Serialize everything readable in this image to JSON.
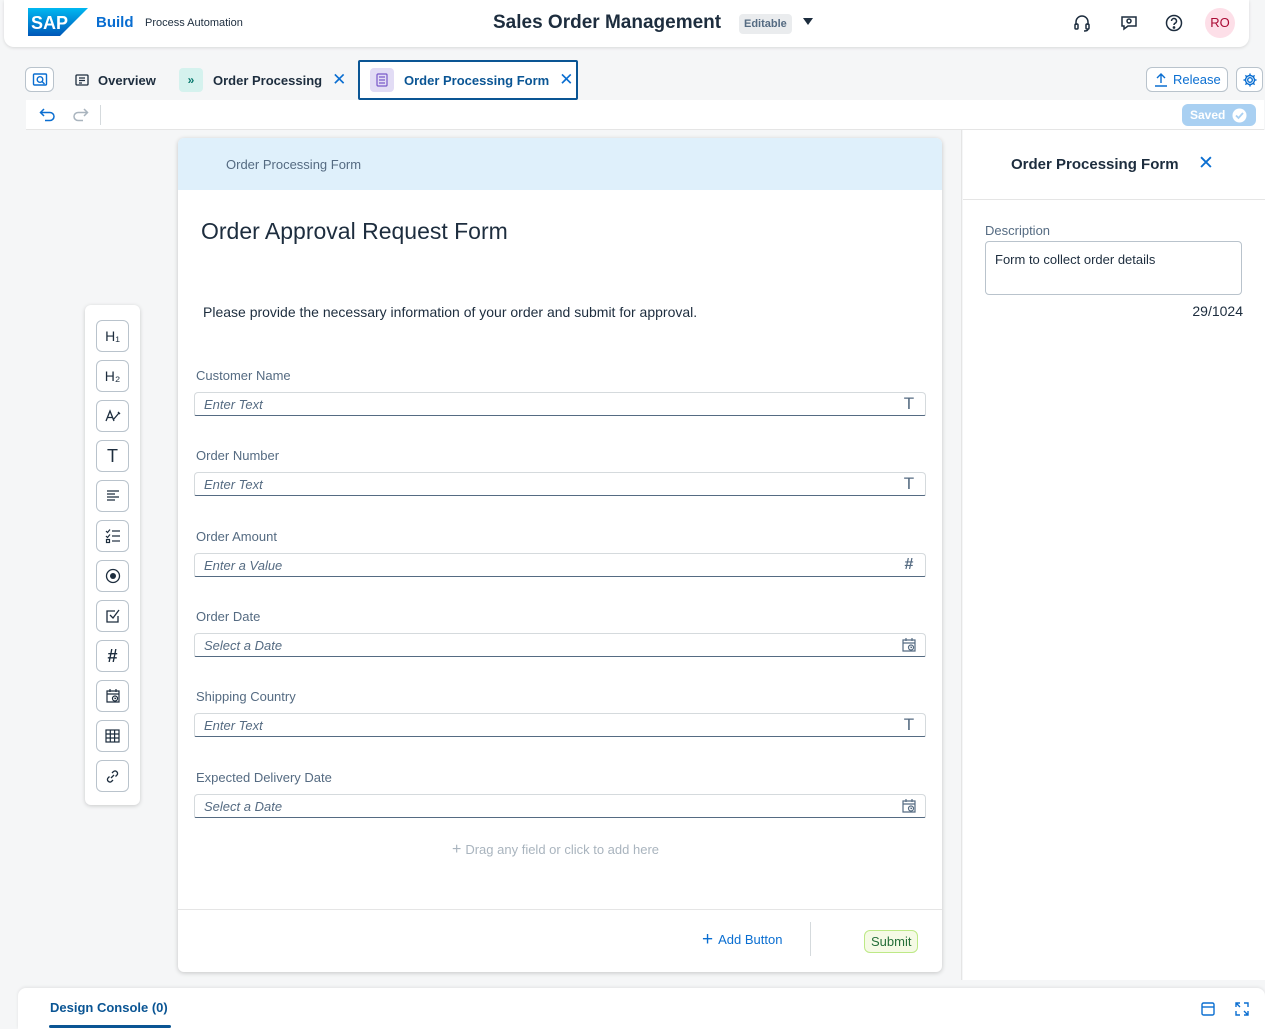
{
  "shell": {
    "brand": "SAP",
    "product": "Build",
    "subproduct": "Process Automation",
    "title": "Sales Order Management",
    "status_badge": "Editable",
    "avatar_initials": "RO"
  },
  "tabs": [
    {
      "label": "Overview"
    },
    {
      "label": "Order Processing"
    },
    {
      "label": "Order Processing Form"
    }
  ],
  "actions": {
    "release_label": "Release",
    "saved_label": "Saved"
  },
  "form": {
    "header_label": "Order Processing Form",
    "title": "Order Approval Request Form",
    "description": "Please provide the necessary information of your order and submit for approval.",
    "fields": [
      {
        "label": "Customer Name",
        "placeholder": "Enter Text",
        "icon": "text-type-icon"
      },
      {
        "label": "Order Number",
        "placeholder": "Enter Text",
        "icon": "text-type-icon"
      },
      {
        "label": "Order Amount",
        "placeholder": "Enter a Value",
        "icon": "number-type-icon"
      },
      {
        "label": "Order Date",
        "placeholder": "Select a Date",
        "icon": "calendar-icon"
      },
      {
        "label": "Shipping Country",
        "placeholder": "Enter Text",
        "icon": "text-type-icon"
      },
      {
        "label": "Expected Delivery Date",
        "placeholder": "Select a Date",
        "icon": "calendar-icon"
      }
    ],
    "drag_hint": "Drag any field or click to add here",
    "add_button_label": "Add Button",
    "submit_label": "Submit"
  },
  "palette": {
    "h1": "H₁",
    "h2": "H₂"
  },
  "panel": {
    "title": "Order Processing Form",
    "description_label": "Description",
    "description_value": "Form to collect order details",
    "char_count": "29/1024"
  },
  "console": {
    "tab_label": "Design Console (0)"
  },
  "colors": {
    "accent": "#0a6ed1",
    "active_tab": "#0a5594",
    "form_header_bg": "#dff0fb",
    "saved_bg": "#a9d0f2"
  }
}
